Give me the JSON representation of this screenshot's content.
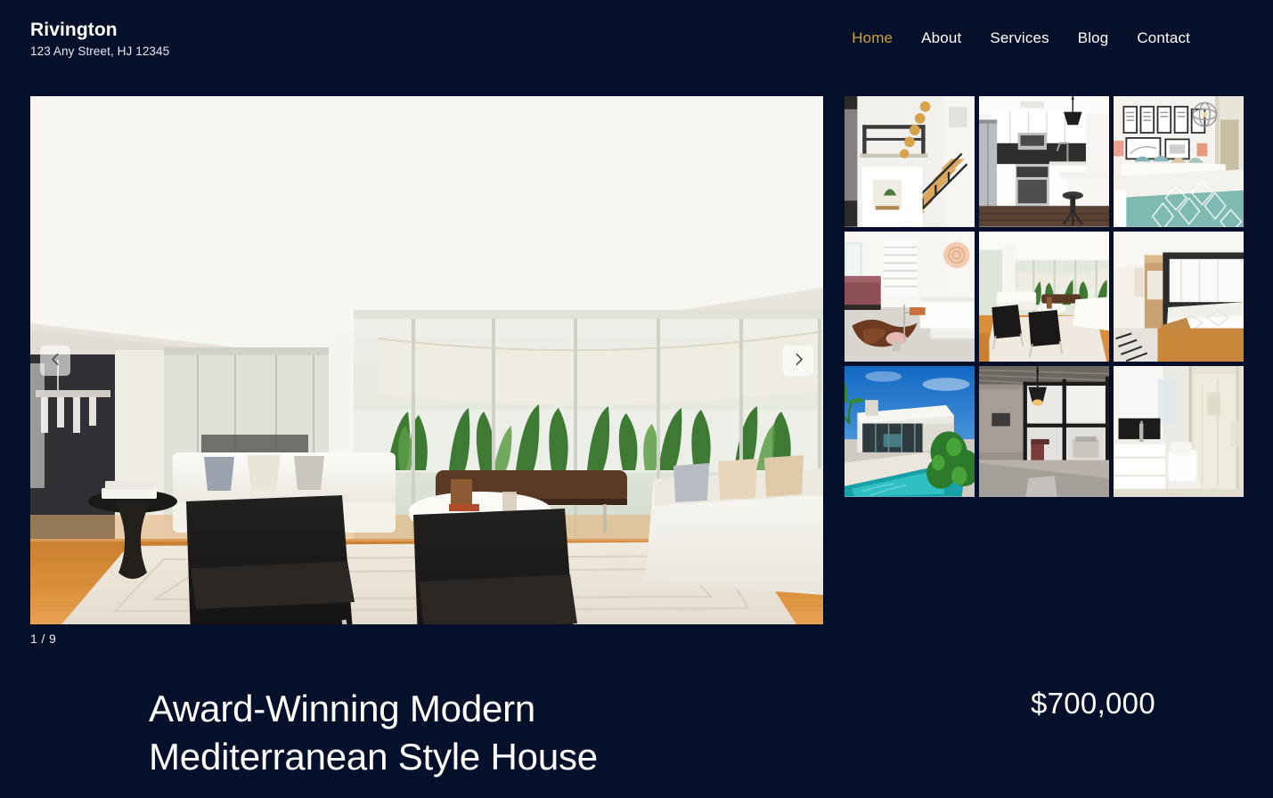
{
  "theme": {
    "background": "#07102a",
    "accent": "#c8a14a",
    "text": "#ffffff"
  },
  "header": {
    "brand_name": "Rivington",
    "brand_address": "123 Any Street, HJ 12345",
    "nav": [
      {
        "label": "Home",
        "active": true
      },
      {
        "label": "About",
        "active": false
      },
      {
        "label": "Services",
        "active": false
      },
      {
        "label": "Blog",
        "active": false
      },
      {
        "label": "Contact",
        "active": false
      }
    ]
  },
  "gallery": {
    "counter": "1 / 9",
    "prev_label": "Previous image",
    "next_label": "Next image",
    "hero": {
      "alt": "Bright modern living room with floor-to-ceiling glass doors, white sofas, black velvet armchairs and outdoor patio with plants"
    },
    "thumbnails": [
      {
        "index": 1,
        "alt": "Staircase with pendant lights and open loft landing"
      },
      {
        "index": 2,
        "alt": "White kitchen with black tile backsplash and stainless appliances"
      },
      {
        "index": 3,
        "alt": "Bedroom with framed art gallery wall and teal patterned bedding"
      },
      {
        "index": 4,
        "alt": "Bedroom lounge with cowhide rug, shutters and white bath tub"
      },
      {
        "index": 5,
        "alt": "Living room with glass walls, white sofas and black armchairs"
      },
      {
        "index": 6,
        "alt": "Master bedroom with black canopy bed frame and sheer curtains"
      },
      {
        "index": 7,
        "alt": "Exterior of modern house with swimming pool and palm trees"
      },
      {
        "index": 8,
        "alt": "Hallway with black framed glass partition and pendant lamp"
      },
      {
        "index": 9,
        "alt": "White bathroom with glass shower, vanity and toilet"
      }
    ]
  },
  "listing": {
    "title": "Award-Winning Modern Mediterranean Style House",
    "price": "$700,000"
  }
}
